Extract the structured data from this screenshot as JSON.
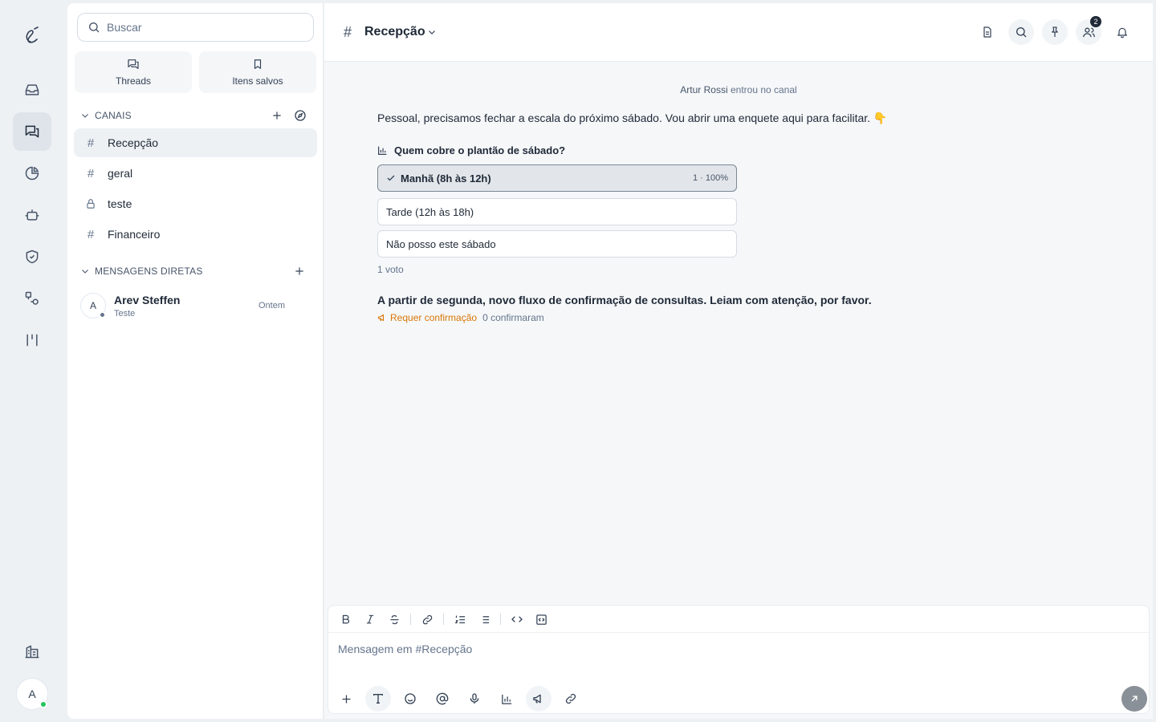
{
  "sidebar": {
    "search_placeholder": "Buscar",
    "quick": {
      "threads": "Threads",
      "saved": "Itens salvos"
    },
    "channels_title": "CANAIS",
    "channels": [
      {
        "name": "Recepção",
        "kind": "hash",
        "active": true
      },
      {
        "name": "geral",
        "kind": "hash"
      },
      {
        "name": "teste",
        "kind": "lock"
      },
      {
        "name": "Financeiro",
        "kind": "hash"
      }
    ],
    "dms_title": "MENSAGENS DIRETAS",
    "dms": [
      {
        "initial": "A",
        "name": "Arev Steffen",
        "preview": "Teste",
        "time": "Ontem"
      }
    ]
  },
  "rail": {
    "avatar_initial": "A"
  },
  "header": {
    "hash": "#",
    "title": "Recepção",
    "members_badge": "2"
  },
  "feed": {
    "join_user": "Artur Rossi",
    "join_text": "entrou no canal",
    "message": "Pessoal, precisamos fechar a escala do próximo sábado. Vou abrir uma enquete aqui para facilitar. 👇",
    "poll": {
      "question": "Quem cobre o plantão de sábado?",
      "options": [
        {
          "label": "Manhã (8h às 12h)",
          "stat": "1 · 100%",
          "votes": 1,
          "percent": 100,
          "selected": true
        },
        {
          "label": "Tarde (12h às 18h)"
        },
        {
          "label": "Não posso este sábado"
        }
      ],
      "total": "1 voto"
    },
    "announcement": "A partir de segunda, novo fluxo de confirmação de consultas. Leiam com atenção, por favor.",
    "ack_label": "Requer confirmação",
    "ack_count": "0 confirmaram"
  },
  "composer": {
    "placeholder": "Mensagem em #Recepção"
  },
  "colors": {
    "accent_warning": "#d97706",
    "online": "#22c55e"
  }
}
